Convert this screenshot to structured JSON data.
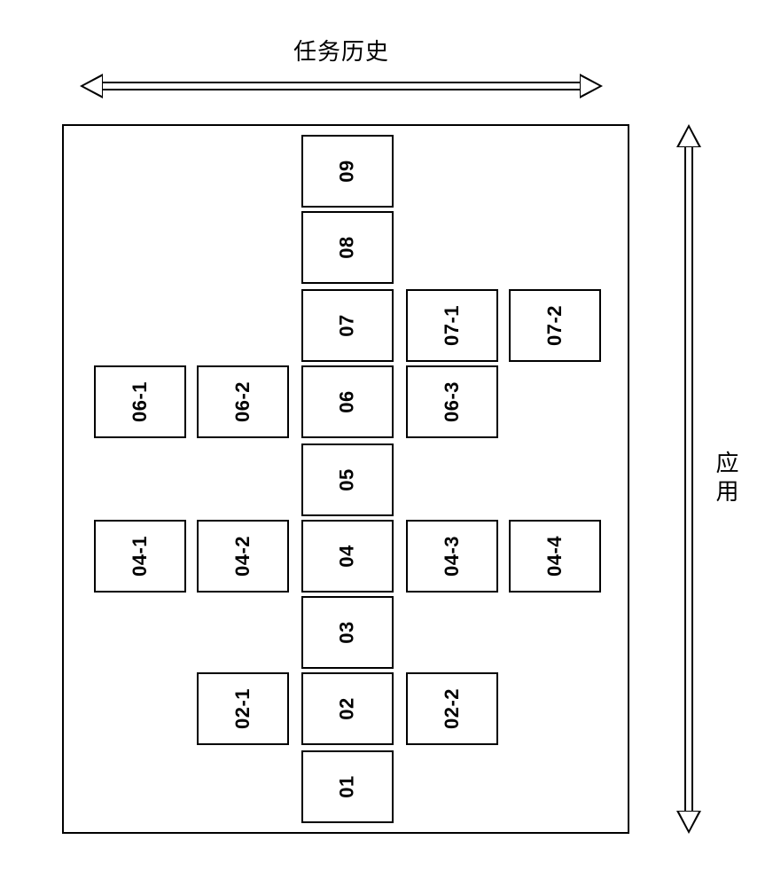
{
  "axes": {
    "horizontal_label": "任务历史",
    "vertical_label": "应用"
  },
  "cells": {
    "r1c0": "09",
    "r2c0": "08",
    "r3c0": "07",
    "r3rp1": "07-1",
    "r3rp2": "07-2",
    "r4lm2": "06-1",
    "r4lm1": "06-2",
    "r4c0": "06",
    "r4rp1": "06-3",
    "r5c0": "05",
    "r6lm2": "04-1",
    "r6lm1": "04-2",
    "r6c0": "04",
    "r6rp1": "04-3",
    "r6rp2": "04-4",
    "r7c0": "03",
    "r8lm1": "02-1",
    "r8c0": "02",
    "r8rp1": "02-2",
    "r9c0": "01"
  }
}
